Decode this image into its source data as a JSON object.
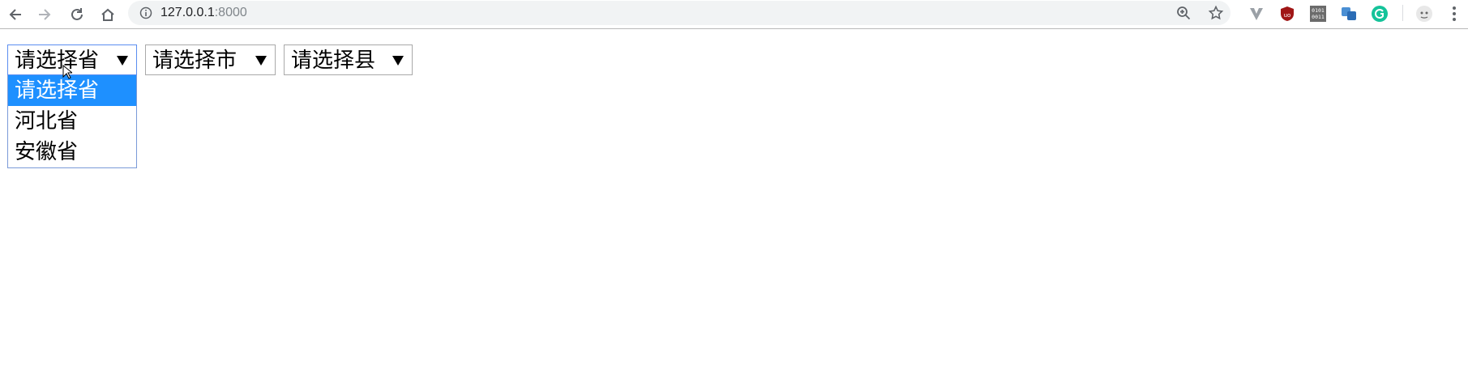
{
  "browser": {
    "url_host": "127.0.0.1",
    "url_port": ":8000",
    "extensions": [
      "vimium-icon",
      "ublock-icon",
      "binary-icon",
      "translate-icon",
      "grammarly-icon",
      "profile-icon"
    ]
  },
  "selects": {
    "province": {
      "selected": "请选择省"
    },
    "city": {
      "selected": "请选择市"
    },
    "county": {
      "selected": "请选择县"
    }
  },
  "dropdown": {
    "options": [
      "请选择省",
      "河北省",
      "安徽省"
    ],
    "highlighted_index": 0,
    "highlight_color": "#1e90ff"
  }
}
